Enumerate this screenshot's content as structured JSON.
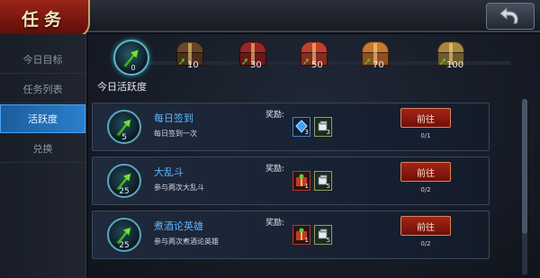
{
  "header": {
    "title": "任务",
    "back_icon": "back-arrow-icon"
  },
  "sidebar": {
    "items": [
      {
        "label": "今日目标",
        "active": false
      },
      {
        "label": "任务列表",
        "active": false
      },
      {
        "label": "活跃度",
        "active": true
      },
      {
        "label": "兑换",
        "active": false
      }
    ]
  },
  "activity": {
    "label": "今日活跃度",
    "current": "0",
    "chests": [
      {
        "value": "10",
        "color": "#5a3a22"
      },
      {
        "value": "30",
        "color": "#8a1f1f"
      },
      {
        "value": "50",
        "color": "#b2352a"
      },
      {
        "value": "70",
        "color": "#b86a2a"
      },
      {
        "value": "100",
        "color": "#9a7a35"
      }
    ]
  },
  "tasks": [
    {
      "points": "5",
      "name": "每日签到",
      "desc": "每日签到一次",
      "reward_label": "奖励:",
      "rewards": [
        {
          "icon": "blue-gem-icon",
          "count": "3"
        },
        {
          "icon": "fist-token-icon",
          "count": "3"
        }
      ],
      "button": "前往",
      "progress": "0/1"
    },
    {
      "points": "25",
      "name": "大乱斗",
      "desc": "参与两次大乱斗",
      "reward_label": "奖励:",
      "rewards": [
        {
          "icon": "gift-pack-icon",
          "count": "1"
        },
        {
          "icon": "fist-token-icon",
          "count": "5"
        }
      ],
      "button": "前往",
      "progress": "0/2"
    },
    {
      "points": "25",
      "name": "煮酒论英雄",
      "desc": "参与两次煮酒论英雄",
      "reward_label": "奖励:",
      "rewards": [
        {
          "icon": "gift-pack-icon",
          "count": "1"
        },
        {
          "icon": "fist-token-icon",
          "count": "5"
        }
      ],
      "button": "前往",
      "progress": "0/2"
    }
  ],
  "colors": {
    "accent": "#2b7fcc",
    "task_name": "#5db6ff",
    "button": "#a52418",
    "arrow": "#4fd23a"
  }
}
